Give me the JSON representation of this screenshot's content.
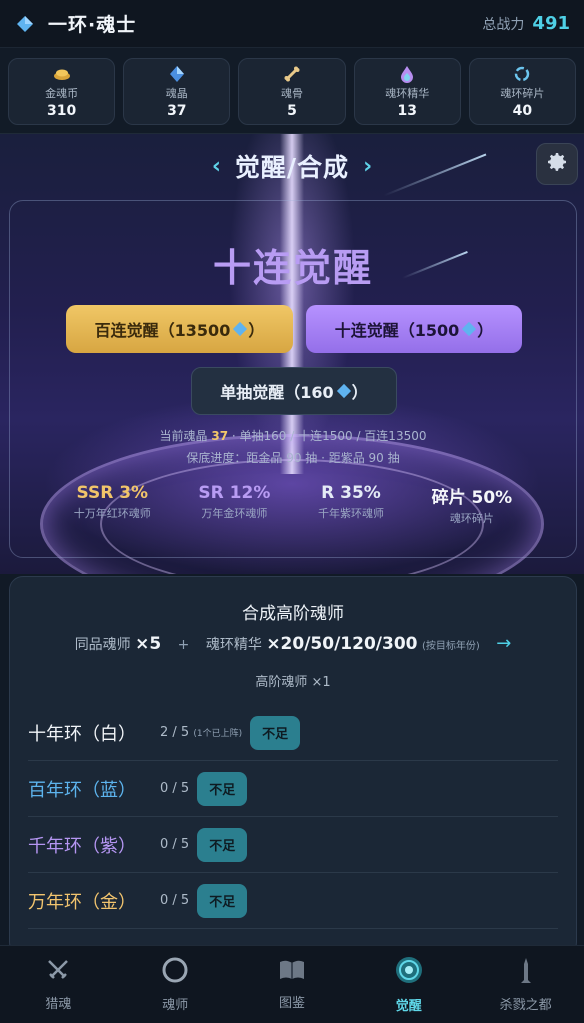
{
  "header": {
    "title": "一环·魂士",
    "power_label": "总战力",
    "power_value": "491"
  },
  "resources": [
    {
      "label": "金魂币",
      "value": "310",
      "icon": "coin-icon"
    },
    {
      "label": "魂晶",
      "value": "37",
      "icon": "crystal-icon"
    },
    {
      "label": "魂骨",
      "value": "5",
      "icon": "bone-icon"
    },
    {
      "label": "魂环精华",
      "value": "13",
      "icon": "essence-icon"
    },
    {
      "label": "魂环碎片",
      "value": "40",
      "icon": "ring-fragment-icon"
    }
  ],
  "page": {
    "prev": "‹",
    "title": "觉醒/合成",
    "next": "›"
  },
  "gacha": {
    "big_title": "十连觉醒",
    "btn_hundred": "百连觉醒（13500",
    "btn_ten": "十连觉醒（1500",
    "btn_single": "单抽觉醒（160",
    "close_paren": "）",
    "info_prefix": "当前魂晶",
    "info_value": "37",
    "info_suffix": "· 单抽160 / 十连1500 / 百连13500",
    "pity": "保底进度：距金品 90 抽 · 距紫品 90 抽",
    "rates": [
      {
        "rate": "SSR 3%",
        "desc": "十万年红环魂师"
      },
      {
        "rate": "SR 12%",
        "desc": "万年金环魂师"
      },
      {
        "rate": "R 35%",
        "desc": "千年紫环魂师"
      },
      {
        "rate": "碎片 50%",
        "desc": "魂环碎片"
      }
    ]
  },
  "synth": {
    "title": "合成高阶魂师",
    "same_label": "同品魂师",
    "same_count": "×5",
    "plus": "+",
    "essence_label": "魂环精华",
    "essence_count": "×20/50/120/300",
    "essence_note": "(按目标年份)",
    "arrow": "→",
    "result": "高阶魂师 ×1",
    "rows": [
      {
        "name": "十年环（白）",
        "progress": "2 / 5",
        "note": "(1个已上阵)",
        "status": "不足"
      },
      {
        "name": "百年环（蓝）",
        "progress": "0 / 5",
        "note": "",
        "status": "不足"
      },
      {
        "name": "千年环（紫）",
        "progress": "0 / 5",
        "note": "",
        "status": "不足"
      },
      {
        "name": "万年环（金）",
        "progress": "0 / 5",
        "note": "",
        "status": "不足"
      }
    ]
  },
  "nav": [
    {
      "label": "猎魂",
      "icon": "crossed-swords-icon"
    },
    {
      "label": "魂师",
      "icon": "ring-icon"
    },
    {
      "label": "图鉴",
      "icon": "book-icon"
    },
    {
      "label": "觉醒",
      "icon": "awaken-orb-icon"
    },
    {
      "label": "杀戮之都",
      "icon": "tower-icon"
    }
  ],
  "colors": {
    "accent": "#4fd0e6",
    "gold": "#f0c766",
    "purple": "#b692ff"
  }
}
